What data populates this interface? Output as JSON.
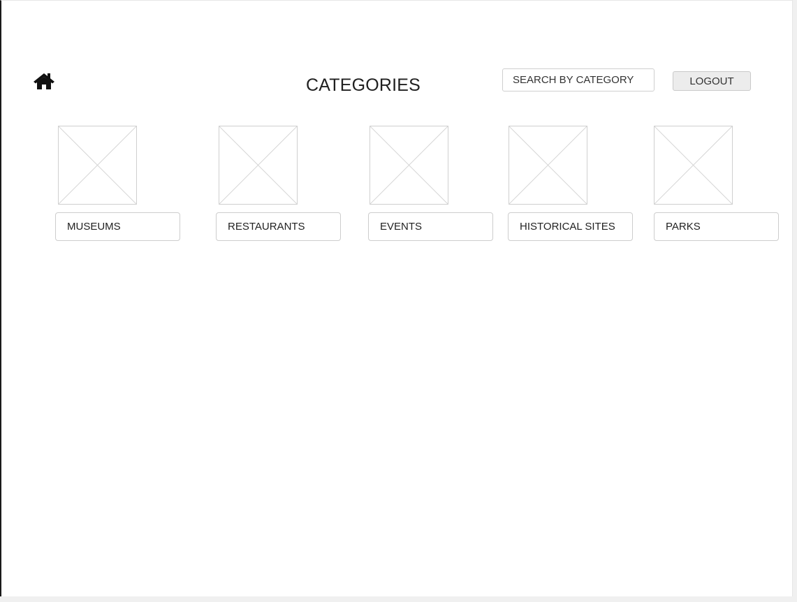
{
  "header": {
    "home_icon": "home-icon",
    "title": "CATEGORIES",
    "search_placeholder": "SEARCH BY CATEGORY",
    "logout_label": "LOGOUT"
  },
  "categories": [
    {
      "label": "MUSEUMS",
      "image_icon": "image-placeholder-icon"
    },
    {
      "label": "RESTAURANTS",
      "image_icon": "image-placeholder-icon"
    },
    {
      "label": "EVENTS",
      "image_icon": "image-placeholder-icon"
    },
    {
      "label": "HISTORICAL SITES",
      "image_icon": "image-placeholder-icon"
    },
    {
      "label": "PARKS",
      "image_icon": "image-placeholder-icon"
    }
  ]
}
